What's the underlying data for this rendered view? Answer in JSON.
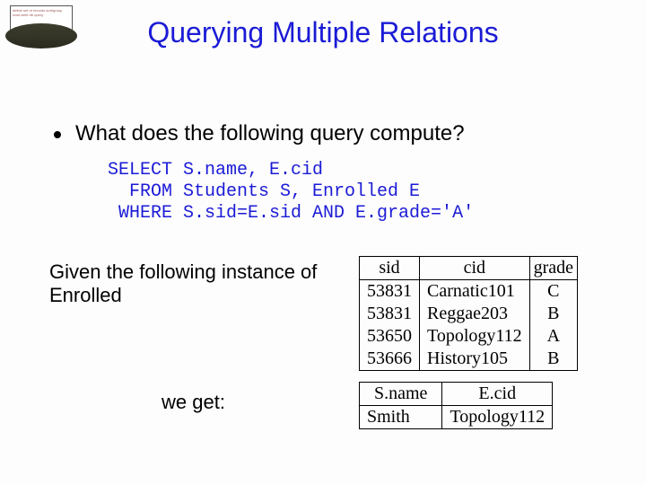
{
  "title": "Querying Multiple Relations",
  "bullet": "What does the following query compute?",
  "sql": "SELECT S.name, E.cid\n  FROM Students S, Enrolled E\n WHERE S.sid=E.sid AND E.grade='A'",
  "given_text": "Given the following instance of Enrolled",
  "weget_text": "we get:",
  "icon_text": "define set of records sort/group read write db query",
  "enrolled": {
    "headers": [
      "sid",
      "cid",
      "grade"
    ],
    "rows": [
      [
        "53831",
        "Carnatic101",
        "C"
      ],
      [
        "53831",
        "Reggae203",
        "B"
      ],
      [
        "53650",
        "Topology112",
        "A"
      ],
      [
        "53666",
        "History105",
        "B"
      ]
    ]
  },
  "result": {
    "headers": [
      "S.name",
      "E.cid"
    ],
    "rows": [
      [
        "Smith",
        "Topology112"
      ]
    ]
  }
}
